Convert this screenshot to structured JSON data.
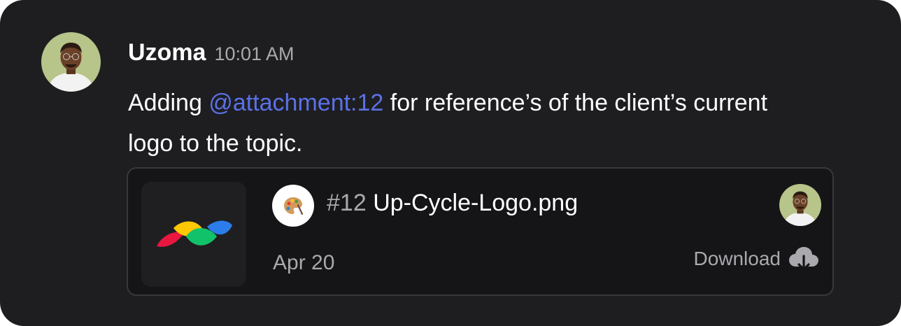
{
  "message": {
    "author": "Uzoma",
    "time": "10:01 AM",
    "text_before": "Adding ",
    "mention": "@attachment:12",
    "text_after": " for reference’s of the client’s current logo to the topic.",
    "mention_color": "#5b71e8"
  },
  "attachment": {
    "number": "#12",
    "file_name": "Up-Cycle-Logo.png",
    "date": "Apr 20",
    "download_label": "Download",
    "file_icon": "palette-icon",
    "logo_colors": [
      "#e8173f",
      "#ffc800",
      "#12c26a",
      "#2b7de9"
    ]
  },
  "icons": {
    "avatar": "user-avatar",
    "download": "cloud-download-icon"
  },
  "colors": {
    "card_bg": "#1e1e21",
    "attachment_bg": "#151517",
    "muted_text": "#a9a9ae"
  }
}
